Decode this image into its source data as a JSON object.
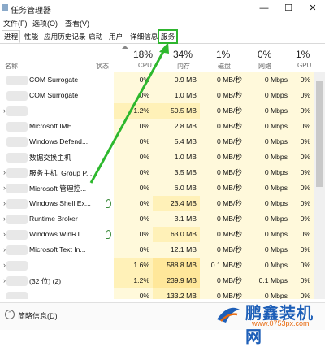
{
  "window": {
    "title": "任务管理器",
    "min": "—",
    "max": "☐",
    "close": "✕"
  },
  "menu": [
    "文件(F)",
    "选项(O)",
    "查看(V)"
  ],
  "tabs": [
    "进程",
    "性能",
    "应用历史记录",
    "启动",
    "用户",
    "详细信息",
    "服务"
  ],
  "header": {
    "name": "名称",
    "status": "状态",
    "cpu_pct": "18%",
    "cpu_label": "CPU",
    "mem_pct": "34%",
    "mem_label": "内存",
    "disk_pct": "1%",
    "disk_label": "磁盘",
    "net_pct": "0%",
    "net_label": "网络",
    "gpu_pct": "1%",
    "gpu_label": "GPU"
  },
  "rows": [
    {
      "name": "COM Surrogate",
      "cpu": "0%",
      "mem": "0.9 MB",
      "disk": "0 MB/秒",
      "net": "0 Mbps",
      "gpu": "0%"
    },
    {
      "name": "COM Surrogate",
      "cpu": "0%",
      "mem": "1.0 MB",
      "disk": "0 MB/秒",
      "net": "0 Mbps",
      "gpu": "0%"
    },
    {
      "name": "",
      "cpu": "1.2%",
      "mem": "50.5 MB",
      "disk": "0 MB/秒",
      "net": "0 Mbps",
      "gpu": "0%"
    },
    {
      "name": "Microsoft IME",
      "cpu": "0%",
      "mem": "2.8 MB",
      "disk": "0 MB/秒",
      "net": "0 Mbps",
      "gpu": "0%"
    },
    {
      "name": "Windows Defend...",
      "cpu": "0%",
      "mem": "5.4 MB",
      "disk": "0 MB/秒",
      "net": "0 Mbps",
      "gpu": "0%"
    },
    {
      "name": "数据交换主机",
      "cpu": "0%",
      "mem": "1.0 MB",
      "disk": "0 MB/秒",
      "net": "0 Mbps",
      "gpu": "0%"
    },
    {
      "name": "服务主机: Group P...",
      "cpu": "0%",
      "mem": "3.5 MB",
      "disk": "0 MB/秒",
      "net": "0 Mbps",
      "gpu": "0%"
    },
    {
      "name": "Microsoft 管理控...",
      "cpu": "0%",
      "mem": "6.0 MB",
      "disk": "0 MB/秒",
      "net": "0 Mbps",
      "gpu": "0%"
    },
    {
      "name": "Windows Shell Ex...",
      "cpu": "0%",
      "mem": "23.4 MB",
      "disk": "0 MB/秒",
      "net": "0 Mbps",
      "gpu": "0%"
    },
    {
      "name": "Runtime Broker",
      "cpu": "0%",
      "mem": "3.1 MB",
      "disk": "0 MB/秒",
      "net": "0 Mbps",
      "gpu": "0%"
    },
    {
      "name": "Windows WinRT...",
      "cpu": "0%",
      "mem": "63.0 MB",
      "disk": "0 MB/秒",
      "net": "0 Mbps",
      "gpu": "0%"
    },
    {
      "name": "Microsoft Text In...",
      "cpu": "0%",
      "mem": "12.1 MB",
      "disk": "0 MB/秒",
      "net": "0 Mbps",
      "gpu": "0%"
    },
    {
      "name": "",
      "cpu": "1.6%",
      "mem": "588.8 MB",
      "disk": "0.1 MB/秒",
      "net": "0 Mbps",
      "gpu": "0%"
    },
    {
      "name": "(32 位) (2)",
      "cpu": "1.2%",
      "mem": "239.9 MB",
      "disk": "0 MB/秒",
      "net": "0.1 Mbps",
      "gpu": "0%"
    },
    {
      "name": "",
      "cpu": "0%",
      "mem": "133.2 MB",
      "disk": "0 MB/秒",
      "net": "0 Mbps",
      "gpu": "0%"
    }
  ],
  "footer": {
    "label": "简略信息(D)"
  },
  "watermark": {
    "brand": "鹏鑫装机网",
    "url": "www.0753px.com"
  }
}
